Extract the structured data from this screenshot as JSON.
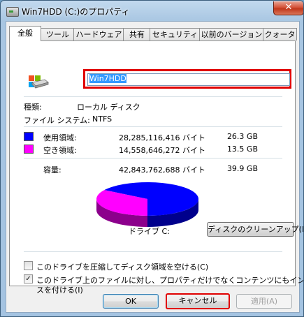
{
  "window": {
    "title": "Win7HDD (C:)のプロパティ",
    "close_symbol": "✕"
  },
  "tabs": [
    "全般",
    "ツール",
    "ハードウェア",
    "共有",
    "セキュリティ",
    "以前のバージョン",
    "クォータ"
  ],
  "general": {
    "drive_name": "Win7HDD",
    "type_label": "種類:",
    "type_value": "ローカル ディスク",
    "fs_label": "ファイル システム:",
    "fs_value": "NTFS",
    "used": {
      "label": "使用領域:",
      "bytes": "28,285,116,416 バイト",
      "size": "26.3 GB",
      "color": "#0000ff"
    },
    "free": {
      "label": "空き領域:",
      "bytes": "14,558,646,272 バイト",
      "size": "13.5 GB",
      "color": "#ff00ff"
    },
    "capacity": {
      "label": "容量:",
      "bytes": "42,843,762,688 バイト",
      "size": "39.9 GB"
    },
    "drive_label": "ドライブ C:",
    "cleanup_button": "ディスクのクリーンアップ(D)",
    "compress_checkbox": {
      "label": "このドライブを圧縮してディスク領域を空ける(C)",
      "checked": false
    },
    "index_checkbox": {
      "label_line1": "このドライブ上のファイルに対し、プロパティだけでなくコンテンツにもインデック",
      "label_line2": "スを付ける(I)",
      "checked": true,
      "check_symbol": "✓"
    }
  },
  "chart_data": {
    "type": "pie",
    "categories": [
      "使用領域",
      "空き領域"
    ],
    "values": [
      28285116416,
      14558646272
    ],
    "colors": [
      "#0000ff",
      "#ff00ff"
    ]
  },
  "buttons": {
    "ok": "OK",
    "cancel": "キャンセル",
    "apply": "適用(A)"
  }
}
